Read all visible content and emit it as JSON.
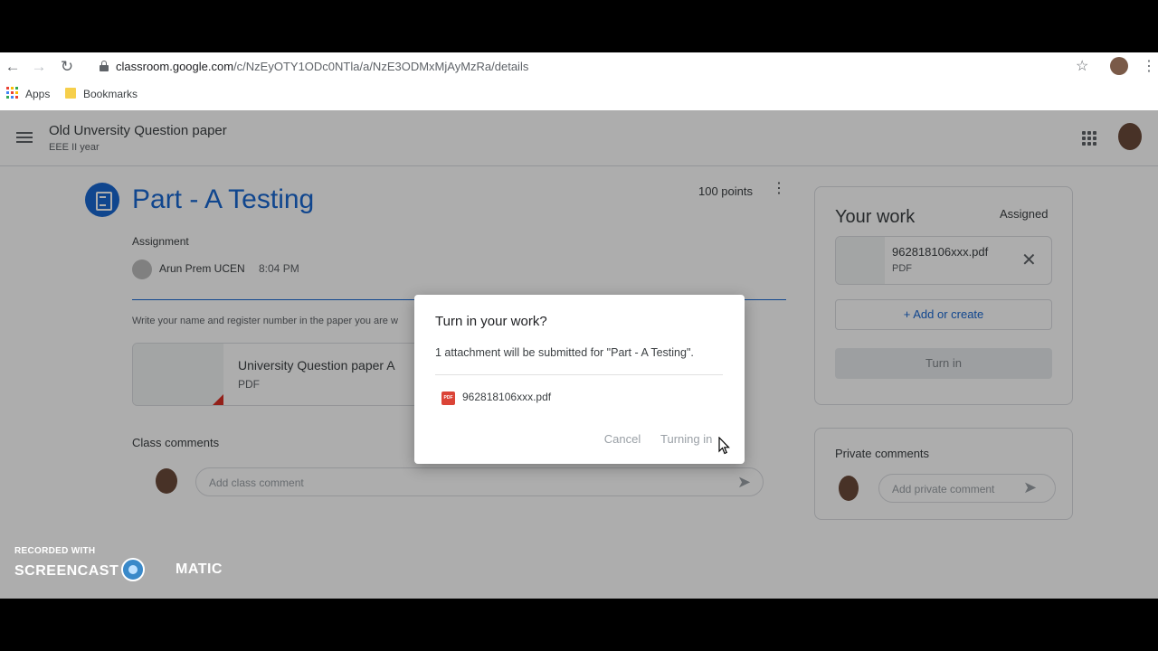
{
  "browser": {
    "url_host": "classroom.google.com",
    "url_path": "/c/NzEyOTY1ODc0NTla/a/NzE3ODMxMjAyMzRa/details",
    "bookmarks": [
      "Apps",
      "Bookmarks"
    ]
  },
  "header": {
    "class_name": "Old Unversity Question paper",
    "section": "EEE II year"
  },
  "assignment": {
    "title": "Part - A Testing",
    "points": "100 points",
    "type_label": "Assignment",
    "teacher": "Arun Prem UCEN",
    "time": "8:04 PM",
    "instructions": "Write your name and register number in the paper you are w",
    "attachment_name": "University Question paper A",
    "attachment_type": "PDF",
    "class_comments_label": "Class comments",
    "class_comment_placeholder": "Add class comment"
  },
  "your_work": {
    "title": "Your work",
    "status": "Assigned",
    "file_name": "962818106xxx.pdf",
    "file_type": "PDF",
    "add_label": "Add or create",
    "turn_in_label": "Turn in"
  },
  "private_comments": {
    "title": "Private comments",
    "placeholder": "Add private comment"
  },
  "dialog": {
    "title": "Turn in your work?",
    "message": "1 attachment will be submitted for \"Part - A Testing\".",
    "file_name": "962818106xxx.pdf",
    "pdf_badge": "PDF",
    "cancel_label": "Cancel",
    "turning_label": "Turning in"
  },
  "watermark": {
    "line1": "RECORDED WITH",
    "line2a": "SCREENCAST",
    "line2b": "MATIC"
  },
  "colors": {
    "accent": "#1967d2",
    "pdf_red": "#db4437"
  }
}
